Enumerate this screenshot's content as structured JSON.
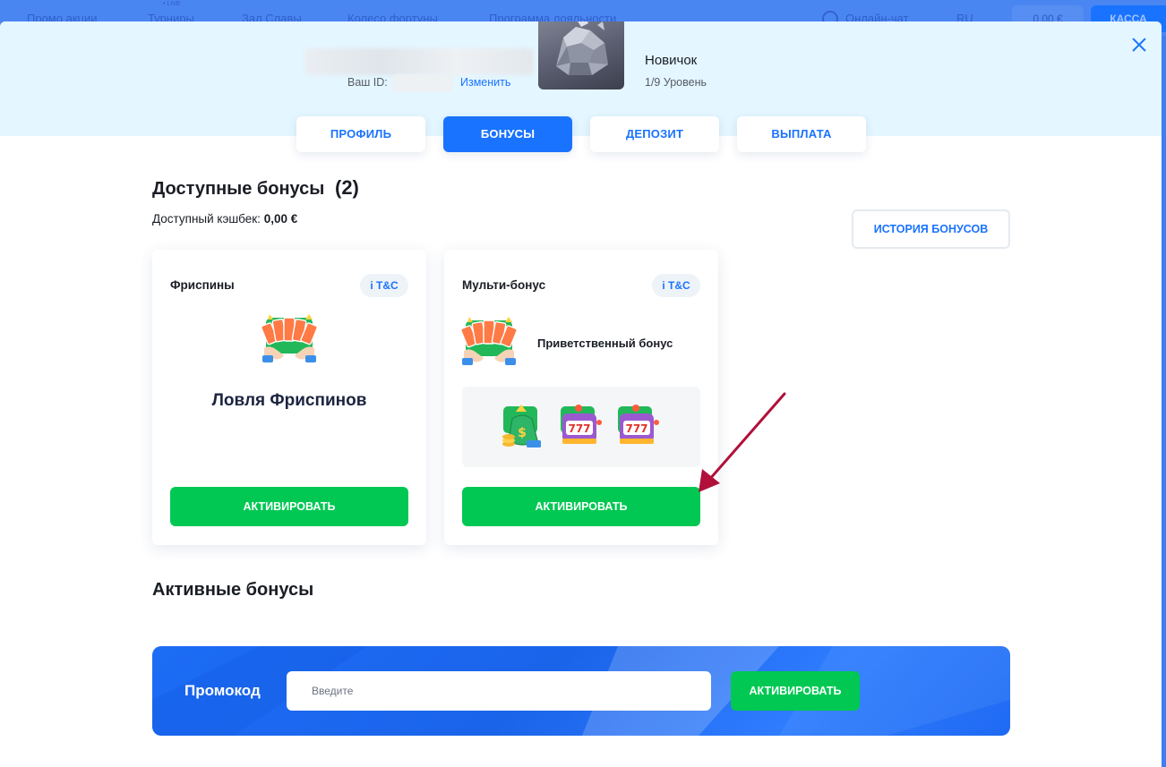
{
  "background_nav": {
    "items": [
      "Промо акции",
      "Турниры",
      "Зал Славы",
      "Колесо фортуны",
      "Программа лояльности",
      "Онлайн-чат",
      "RU"
    ],
    "live_badge": "• LIVE",
    "balance": "0,00 €",
    "cashier": "КАССА"
  },
  "profile": {
    "id_label": "Ваш ID:",
    "change_link": "Изменить",
    "level_name": "Новичок",
    "level_progress": "1/9 Уровень"
  },
  "tabs": [
    {
      "label": "ПРОФИЛЬ",
      "active": false
    },
    {
      "label": "БОНУСЫ",
      "active": true
    },
    {
      "label": "ДЕПОЗИТ",
      "active": false
    },
    {
      "label": "ВЫПЛАТА",
      "active": false
    }
  ],
  "available": {
    "title": "Доступные бонусы",
    "count": "(2)",
    "cashback_label": "Доступный кэшбек:",
    "cashback_value": "0,00 €",
    "history_button": "ИСТОРИЯ БОНУСОВ"
  },
  "cards": [
    {
      "title": "Фриспины",
      "tc": "i T&C",
      "big_title": "Ловля Фриспинов",
      "button": "АКТИВИРОВАТЬ",
      "icon": "cards-fan-icon"
    },
    {
      "title": "Мульти-бонус",
      "tc": "i T&C",
      "subtitle": "Приветственный бонус",
      "button": "АКТИВИРОВАТЬ",
      "icon": "cards-fan-icon",
      "gifts": [
        "money-bag-icon",
        "slot-machine-icon",
        "slot-machine-icon"
      ]
    }
  ],
  "active": {
    "title": "Активные бонусы"
  },
  "promo": {
    "label": "Промокод",
    "placeholder": "Введите",
    "button": "АКТИВИРОВАТЬ"
  },
  "colors": {
    "accent": "#1a73ff",
    "success": "#00c853",
    "header_bg": "#e4f6ff",
    "annotation_arrow": "#b0103a"
  }
}
